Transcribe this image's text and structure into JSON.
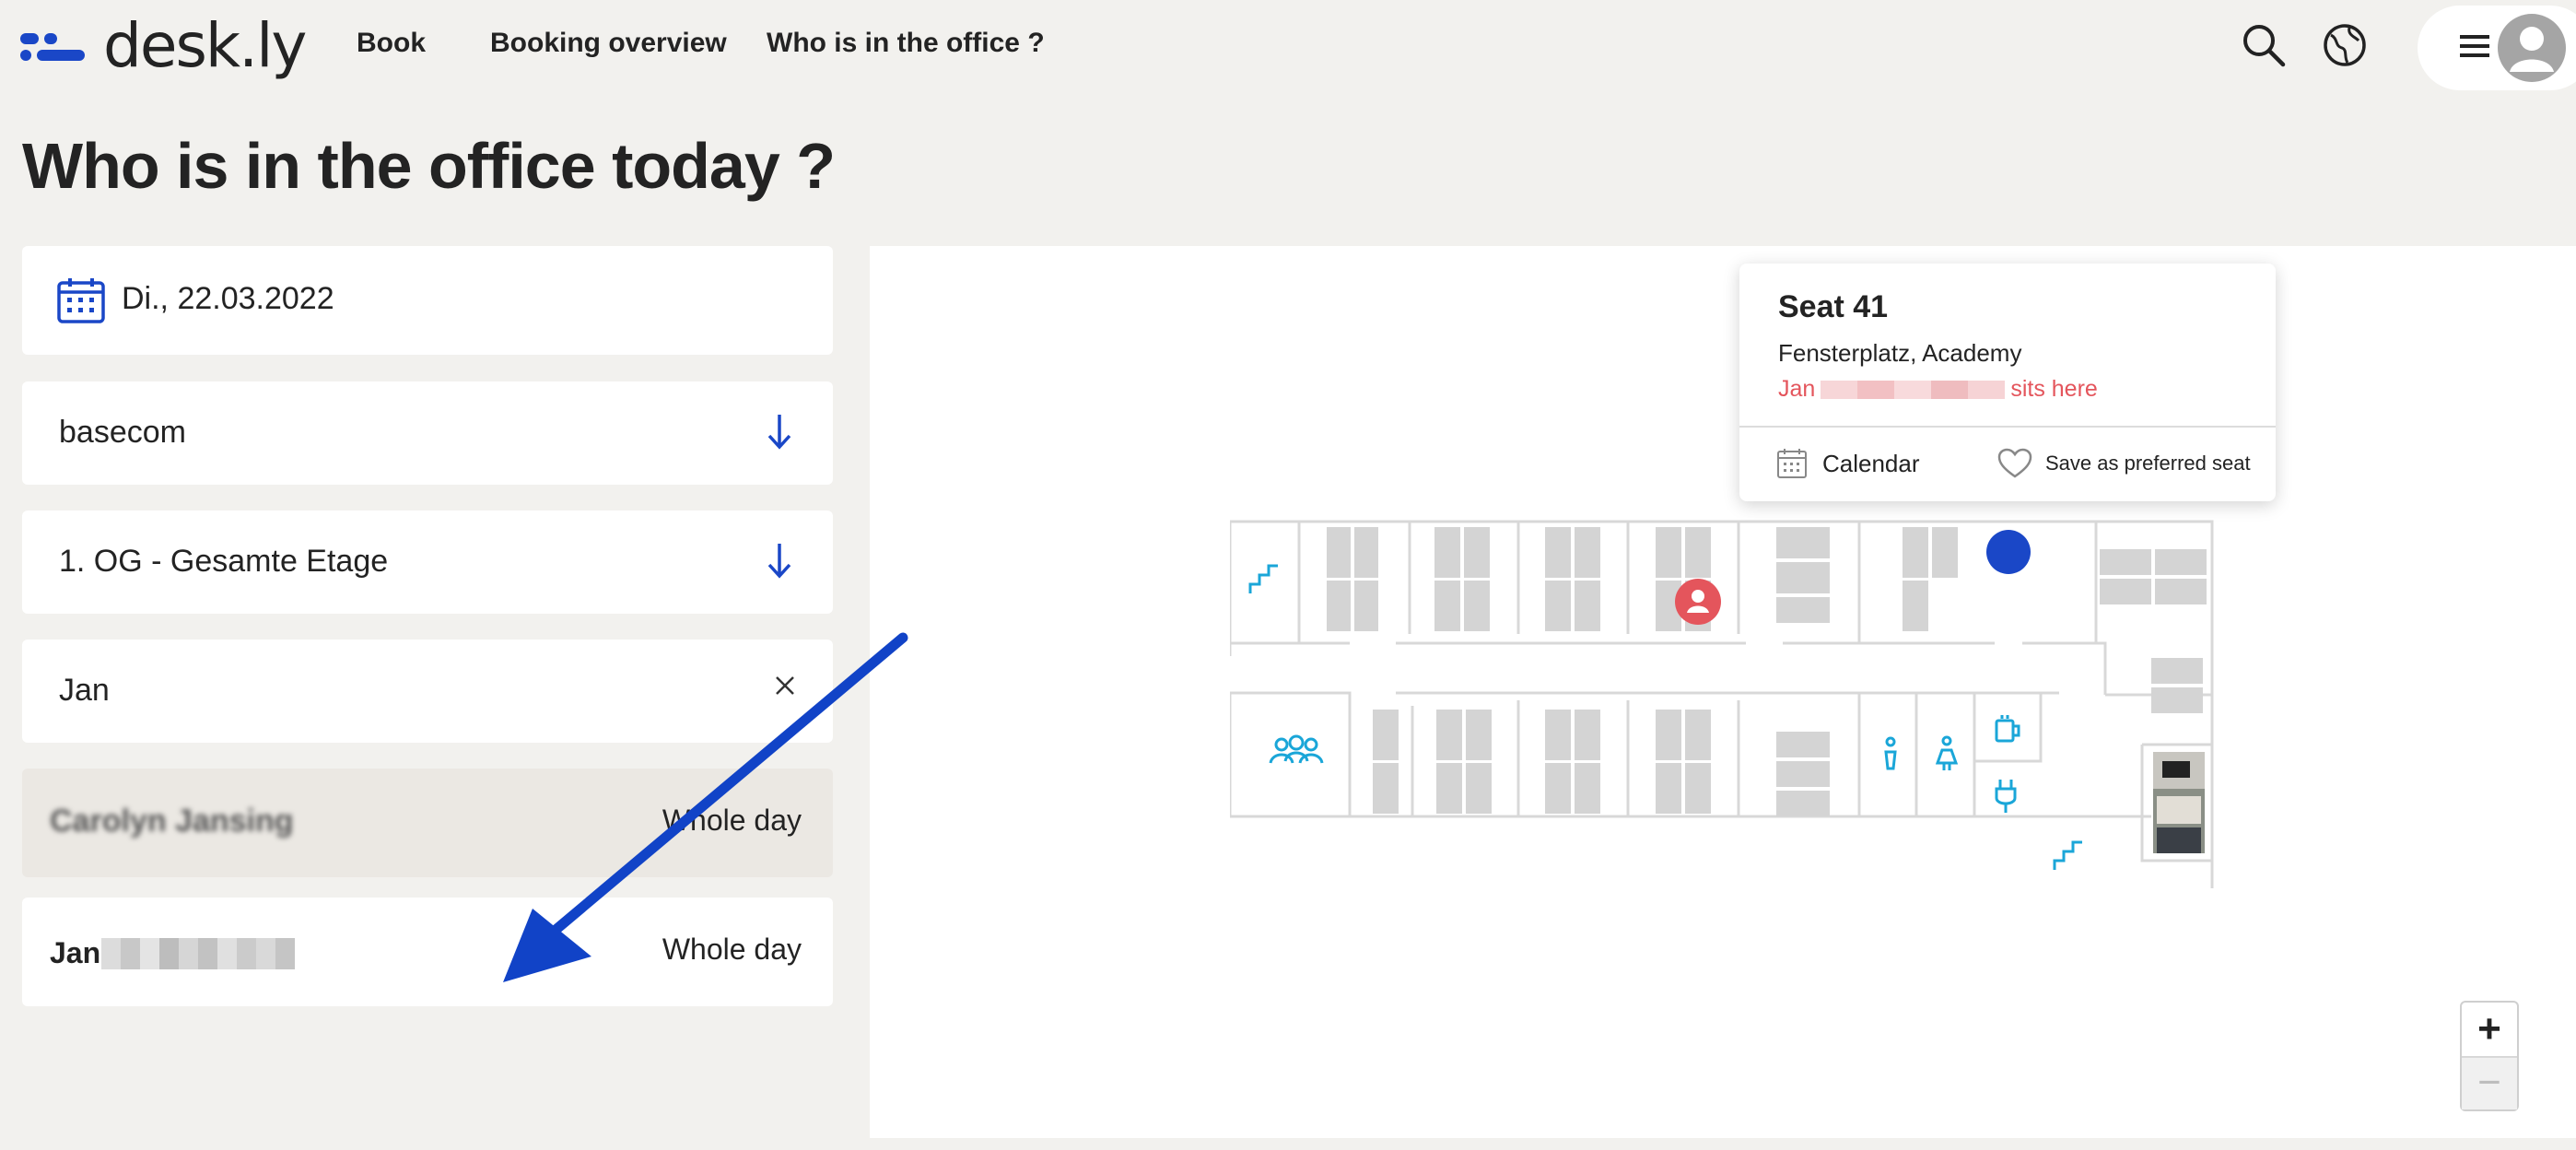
{
  "header": {
    "logo_text": "desk.ly",
    "nav": [
      {
        "label": "Book"
      },
      {
        "label": "Booking overview"
      },
      {
        "label": "Who is in the office ?"
      }
    ]
  },
  "page": {
    "title": "Who is in the office today ?"
  },
  "filters": {
    "date": "Di., 22.03.2022",
    "company": "basecom",
    "floor": "1. OG - Gesamte Etage",
    "search_value": "Jan"
  },
  "results": [
    {
      "name": "Carolyn Jansing",
      "time": "Whole day"
    },
    {
      "name_first": "Jan",
      "time": "Whole day"
    }
  ],
  "popup": {
    "title": "Seat 41",
    "subtitle": "Fensterplatz, Academy",
    "occupant_first": "Jan",
    "occupant_suffix": "sits here",
    "calendar_label": "Calendar",
    "favorite_label": "Save as preferred seat"
  },
  "zoom": {
    "plus": "+",
    "minus": "−"
  },
  "colors": {
    "accent_blue": "#1a47c7",
    "icon_cyan": "#1aa6d8",
    "occupied_red": "#e4555c",
    "background": "#f2f1ee"
  }
}
